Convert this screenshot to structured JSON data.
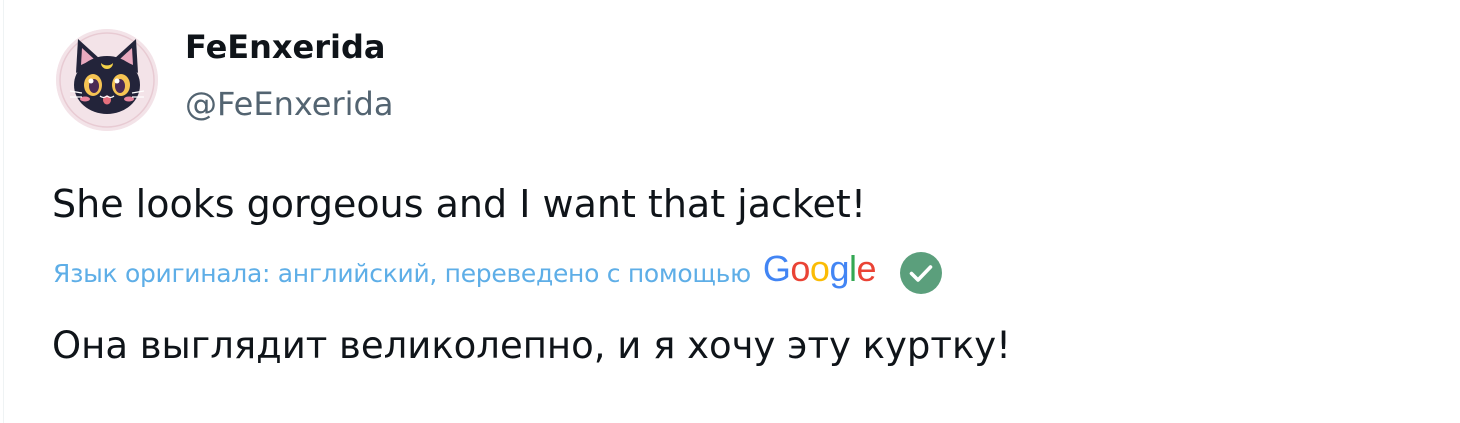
{
  "author": {
    "display_name": "FeEnxerida",
    "handle": "@FeEnxerida",
    "avatar_icon": "black-cat-avatar-icon"
  },
  "tweet": {
    "text": "She looks gorgeous and I want that jacket!"
  },
  "translation": {
    "note": "Язык оригинала: английский, переведено с помощью",
    "provider_letters": [
      {
        "char": "G",
        "color": "#4285F4"
      },
      {
        "char": "o",
        "color": "#EA4335"
      },
      {
        "char": "o",
        "color": "#FBBC05"
      },
      {
        "char": "g",
        "color": "#4285F4"
      },
      {
        "char": "l",
        "color": "#34A853"
      },
      {
        "char": "e",
        "color": "#EA4335"
      }
    ],
    "status_icon": "check-circle-icon",
    "status_color": "#5b9f7c",
    "text": "Она выглядит великолепно, и я хочу эту куртку!"
  },
  "colors": {
    "text_primary": "#0f1419",
    "text_secondary": "#536471",
    "link": "#5eaee7"
  }
}
